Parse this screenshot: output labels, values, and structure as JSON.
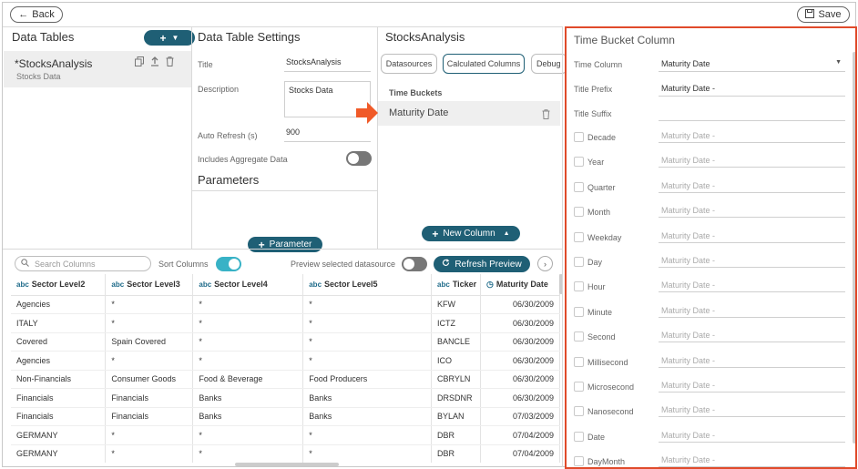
{
  "toolbar": {
    "back_label": "Back",
    "save_label": "Save"
  },
  "data_tables": {
    "title": "Data Tables",
    "item": {
      "name": "*StocksAnalysis",
      "sub": "Stocks Data"
    }
  },
  "settings": {
    "title": "Data Table Settings",
    "title_label": "Title",
    "title_value": "StocksAnalysis",
    "description_label": "Description",
    "description_value": "Stocks Data",
    "auto_refresh_label": "Auto Refresh (s)",
    "auto_refresh_value": "900",
    "aggregate_label": "Includes Aggregate Data",
    "parameters_title": "Parameters",
    "parameter_button": "Parameter"
  },
  "analysis": {
    "title": "StocksAnalysis",
    "tabs": [
      "Datasources",
      "Calculated Columns",
      "Debug"
    ],
    "section_label": "Time Buckets",
    "bucket_item": "Maturity Date",
    "new_column_button": "New Column"
  },
  "grid_toolbar": {
    "search_placeholder": "Search Columns",
    "sort_label": "Sort Columns",
    "preview_label": "Preview selected datasource",
    "refresh_button": "Refresh Preview"
  },
  "grid": {
    "columns": [
      "Sector Level2",
      "Sector Level3",
      "Sector Level4",
      "Sector Level5",
      "Ticker",
      "Maturity Date"
    ],
    "rows": [
      [
        "Agencies",
        "*",
        "*",
        "*",
        "KFW",
        "06/30/2009"
      ],
      [
        "ITALY",
        "*",
        "*",
        "*",
        "ICTZ",
        "06/30/2009"
      ],
      [
        "Covered",
        "Spain Covered",
        "*",
        "*",
        "BANCLE",
        "06/30/2009"
      ],
      [
        "Agencies",
        "*",
        "*",
        "*",
        "ICO",
        "06/30/2009"
      ],
      [
        "Non-Financials",
        "Consumer Goods",
        "Food & Beverage",
        "Food Producers",
        "CBRYLN",
        "06/30/2009"
      ],
      [
        "Financials",
        "Financials",
        "Banks",
        "Banks",
        "DRSDNR",
        "06/30/2009"
      ],
      [
        "Financials",
        "Financials",
        "Banks",
        "Banks",
        "BYLAN",
        "07/03/2009"
      ],
      [
        "GERMANY",
        "*",
        "*",
        "*",
        "DBR",
        "07/04/2009"
      ],
      [
        "GERMANY",
        "*",
        "*",
        "*",
        "DBR",
        "07/04/2009"
      ]
    ]
  },
  "time_bucket": {
    "title": "Time Bucket Column",
    "time_column_label": "Time Column",
    "time_column_value": "Maturity Date",
    "title_prefix_label": "Title Prefix",
    "title_prefix_value": "Maturity Date -",
    "title_suffix_label": "Title Suffix",
    "title_suffix_value": "",
    "buckets": [
      {
        "label": "Decade",
        "value": "Maturity Date -"
      },
      {
        "label": "Year",
        "value": "Maturity Date -"
      },
      {
        "label": "Quarter",
        "value": "Maturity Date -"
      },
      {
        "label": "Month",
        "value": "Maturity Date -"
      },
      {
        "label": "Weekday",
        "value": "Maturity Date -"
      },
      {
        "label": "Day",
        "value": "Maturity Date -"
      },
      {
        "label": "Hour",
        "value": "Maturity Date -"
      },
      {
        "label": "Minute",
        "value": "Maturity Date -"
      },
      {
        "label": "Second",
        "value": "Maturity Date -"
      },
      {
        "label": "Millisecond",
        "value": "Maturity Date -"
      },
      {
        "label": "Microsecond",
        "value": "Maturity Date -"
      },
      {
        "label": "Nanosecond",
        "value": "Maturity Date -"
      },
      {
        "label": "Date",
        "value": "Maturity Date -"
      },
      {
        "label": "DayMonth",
        "value": "Maturity Date -"
      }
    ]
  },
  "colors": {
    "accent": "#1f5f75",
    "toggle_on": "#38b2c6",
    "highlight": "#e04a2a"
  }
}
